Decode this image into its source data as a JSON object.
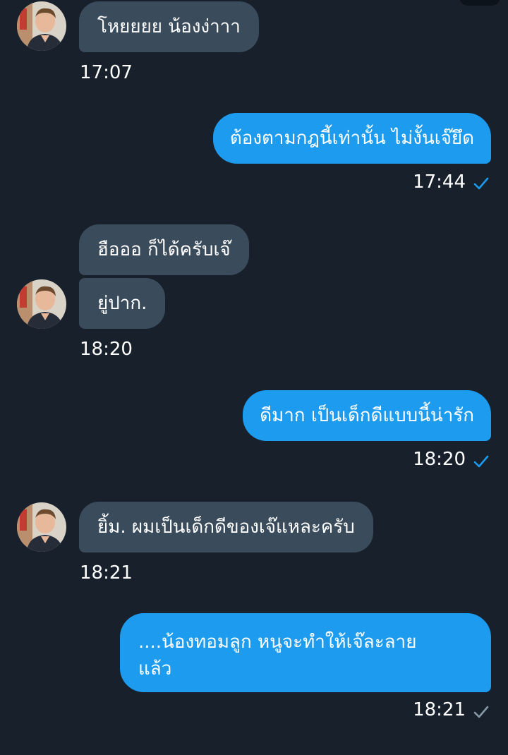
{
  "colors": {
    "background": "#17202b",
    "incoming_bubble": "#3a4b5c",
    "outgoing_bubble": "#1c9bef",
    "check_read": "#1c9bef",
    "check_sent": "#8899a6"
  },
  "messages": [
    {
      "direction": "in",
      "text": "โหยยยย น้องง่าาา"
    },
    {
      "direction": "out",
      "text": "ต้องตามกฎนี้เท่านั้น ไม่งั้นเจ๊ยึด"
    },
    {
      "direction": "in",
      "text": "ฮือออ ก็ได้ครับเจ๊"
    },
    {
      "direction": "in",
      "text": "ยู่ปาก."
    },
    {
      "direction": "out",
      "text": "ดีมาก เป็นเด็กดีแบบนี้น่ารัก"
    },
    {
      "direction": "in",
      "text": "ยิ้ม. ผมเป็นเด็กดีของเจ๊แหละครับ"
    },
    {
      "direction": "out",
      "lines": [
        "....น้องทอมลูก หนูจะทำให้เจ๊ละลาย",
        "แล้ว"
      ]
    }
  ],
  "timestamps": {
    "t1": "17:07",
    "t2": "17:44",
    "t3": "18:20",
    "t4": "18:20",
    "t5": "18:21",
    "t6": "18:21"
  },
  "icons": {
    "avatar": "avatar-icon",
    "read_receipt": "check-icon"
  }
}
